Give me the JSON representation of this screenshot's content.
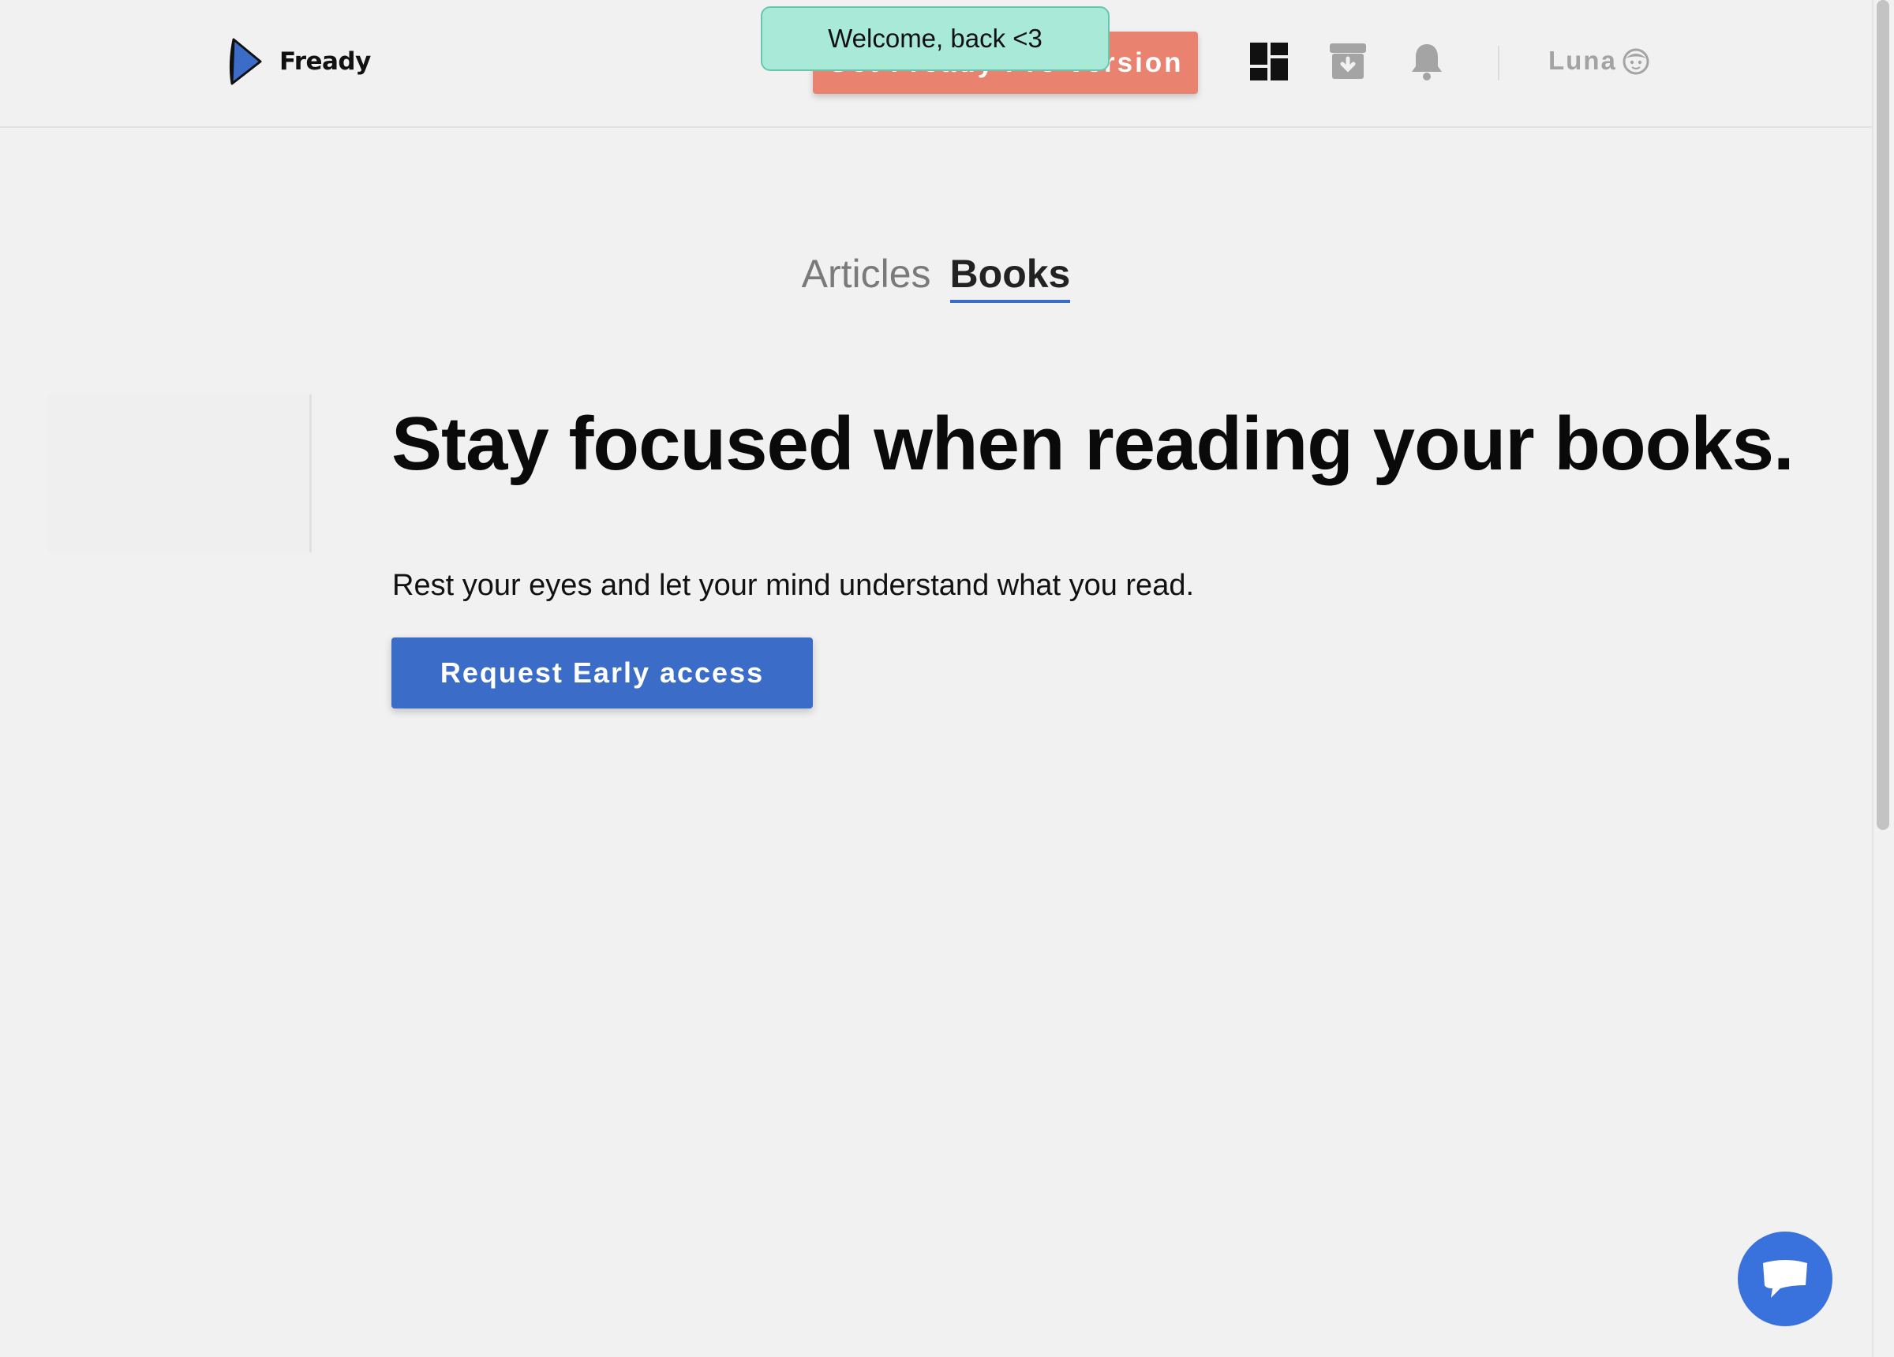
{
  "header": {
    "logo_text": "Fready",
    "pro_button_label": "Get Fready Pro version",
    "user_name": "Luna",
    "icons": [
      "dashboard-icon",
      "archive-icon",
      "bell-icon",
      "avatar-icon"
    ]
  },
  "toast": {
    "message": "Welcome, back <3"
  },
  "tabs": [
    {
      "label": "Articles",
      "active": false
    },
    {
      "label": "Books",
      "active": true
    }
  ],
  "main": {
    "headline": "Stay focused when reading your books.",
    "subtitle": "Rest your eyes and let your mind understand what you read.",
    "cta_label": "Request Early access"
  },
  "chat": {
    "icon": "chat-bubble-icon"
  },
  "colors": {
    "background": "#f1f1f1",
    "brand_blue": "#3b6dc8",
    "pro_button": "#e9826f",
    "toast": "#a9e9d8",
    "chat_button": "#3a72dd"
  }
}
